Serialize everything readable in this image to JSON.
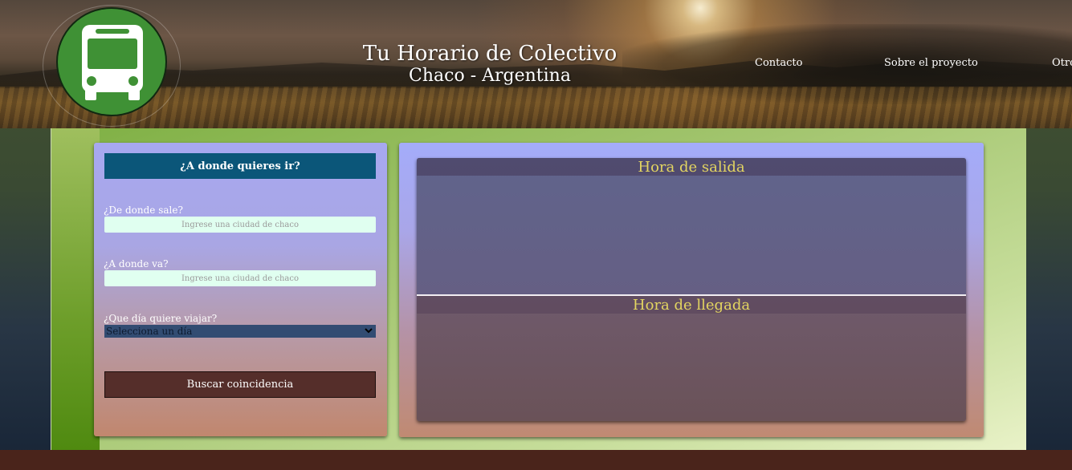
{
  "header": {
    "title": "Tu Horario de Colectivo",
    "subtitle": "Chaco - Argentina",
    "logo_icon": "bus-icon",
    "nav": [
      {
        "label": "Contacto"
      },
      {
        "label": "Sobre el proyecto"
      },
      {
        "label": "Otro"
      }
    ]
  },
  "search": {
    "header": "¿A donde quieres ir?",
    "origin": {
      "label": "¿De donde sale?",
      "placeholder": "Ingrese una ciudad de chaco",
      "value": ""
    },
    "destination": {
      "label": "¿A donde va?",
      "placeholder": "Ingrese una ciudad de chaco",
      "value": ""
    },
    "day": {
      "label": "¿Que día quiere viajar?",
      "selected": "Selecciona un día"
    },
    "button": "Buscar coincidencia"
  },
  "results": {
    "departure_title": "Hora de salida",
    "arrival_title": "Hora de llegada"
  },
  "colors": {
    "panel_header": "#0b5679",
    "button": "#552e2a",
    "section_title": "#e3d561",
    "input_bg": "#e0fff0",
    "footer": "#4a241b",
    "logo_green": "#3f9135"
  }
}
